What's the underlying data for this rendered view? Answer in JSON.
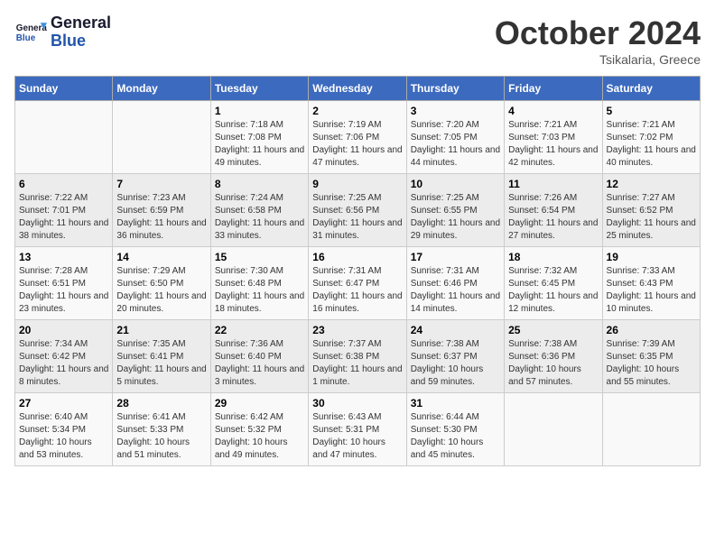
{
  "header": {
    "logo_general": "General",
    "logo_blue": "Blue",
    "month_title": "October 2024",
    "location": "Tsikalaria, Greece"
  },
  "weekdays": [
    "Sunday",
    "Monday",
    "Tuesday",
    "Wednesday",
    "Thursday",
    "Friday",
    "Saturday"
  ],
  "weeks": [
    [
      {
        "day": "",
        "sunrise": "",
        "sunset": "",
        "daylight": ""
      },
      {
        "day": "",
        "sunrise": "",
        "sunset": "",
        "daylight": ""
      },
      {
        "day": "1",
        "sunrise": "Sunrise: 7:18 AM",
        "sunset": "Sunset: 7:08 PM",
        "daylight": "Daylight: 11 hours and 49 minutes."
      },
      {
        "day": "2",
        "sunrise": "Sunrise: 7:19 AM",
        "sunset": "Sunset: 7:06 PM",
        "daylight": "Daylight: 11 hours and 47 minutes."
      },
      {
        "day": "3",
        "sunrise": "Sunrise: 7:20 AM",
        "sunset": "Sunset: 7:05 PM",
        "daylight": "Daylight: 11 hours and 44 minutes."
      },
      {
        "day": "4",
        "sunrise": "Sunrise: 7:21 AM",
        "sunset": "Sunset: 7:03 PM",
        "daylight": "Daylight: 11 hours and 42 minutes."
      },
      {
        "day": "5",
        "sunrise": "Sunrise: 7:21 AM",
        "sunset": "Sunset: 7:02 PM",
        "daylight": "Daylight: 11 hours and 40 minutes."
      }
    ],
    [
      {
        "day": "6",
        "sunrise": "Sunrise: 7:22 AM",
        "sunset": "Sunset: 7:01 PM",
        "daylight": "Daylight: 11 hours and 38 minutes."
      },
      {
        "day": "7",
        "sunrise": "Sunrise: 7:23 AM",
        "sunset": "Sunset: 6:59 PM",
        "daylight": "Daylight: 11 hours and 36 minutes."
      },
      {
        "day": "8",
        "sunrise": "Sunrise: 7:24 AM",
        "sunset": "Sunset: 6:58 PM",
        "daylight": "Daylight: 11 hours and 33 minutes."
      },
      {
        "day": "9",
        "sunrise": "Sunrise: 7:25 AM",
        "sunset": "Sunset: 6:56 PM",
        "daylight": "Daylight: 11 hours and 31 minutes."
      },
      {
        "day": "10",
        "sunrise": "Sunrise: 7:25 AM",
        "sunset": "Sunset: 6:55 PM",
        "daylight": "Daylight: 11 hours and 29 minutes."
      },
      {
        "day": "11",
        "sunrise": "Sunrise: 7:26 AM",
        "sunset": "Sunset: 6:54 PM",
        "daylight": "Daylight: 11 hours and 27 minutes."
      },
      {
        "day": "12",
        "sunrise": "Sunrise: 7:27 AM",
        "sunset": "Sunset: 6:52 PM",
        "daylight": "Daylight: 11 hours and 25 minutes."
      }
    ],
    [
      {
        "day": "13",
        "sunrise": "Sunrise: 7:28 AM",
        "sunset": "Sunset: 6:51 PM",
        "daylight": "Daylight: 11 hours and 23 minutes."
      },
      {
        "day": "14",
        "sunrise": "Sunrise: 7:29 AM",
        "sunset": "Sunset: 6:50 PM",
        "daylight": "Daylight: 11 hours and 20 minutes."
      },
      {
        "day": "15",
        "sunrise": "Sunrise: 7:30 AM",
        "sunset": "Sunset: 6:48 PM",
        "daylight": "Daylight: 11 hours and 18 minutes."
      },
      {
        "day": "16",
        "sunrise": "Sunrise: 7:31 AM",
        "sunset": "Sunset: 6:47 PM",
        "daylight": "Daylight: 11 hours and 16 minutes."
      },
      {
        "day": "17",
        "sunrise": "Sunrise: 7:31 AM",
        "sunset": "Sunset: 6:46 PM",
        "daylight": "Daylight: 11 hours and 14 minutes."
      },
      {
        "day": "18",
        "sunrise": "Sunrise: 7:32 AM",
        "sunset": "Sunset: 6:45 PM",
        "daylight": "Daylight: 11 hours and 12 minutes."
      },
      {
        "day": "19",
        "sunrise": "Sunrise: 7:33 AM",
        "sunset": "Sunset: 6:43 PM",
        "daylight": "Daylight: 11 hours and 10 minutes."
      }
    ],
    [
      {
        "day": "20",
        "sunrise": "Sunrise: 7:34 AM",
        "sunset": "Sunset: 6:42 PM",
        "daylight": "Daylight: 11 hours and 8 minutes."
      },
      {
        "day": "21",
        "sunrise": "Sunrise: 7:35 AM",
        "sunset": "Sunset: 6:41 PM",
        "daylight": "Daylight: 11 hours and 5 minutes."
      },
      {
        "day": "22",
        "sunrise": "Sunrise: 7:36 AM",
        "sunset": "Sunset: 6:40 PM",
        "daylight": "Daylight: 11 hours and 3 minutes."
      },
      {
        "day": "23",
        "sunrise": "Sunrise: 7:37 AM",
        "sunset": "Sunset: 6:38 PM",
        "daylight": "Daylight: 11 hours and 1 minute."
      },
      {
        "day": "24",
        "sunrise": "Sunrise: 7:38 AM",
        "sunset": "Sunset: 6:37 PM",
        "daylight": "Daylight: 10 hours and 59 minutes."
      },
      {
        "day": "25",
        "sunrise": "Sunrise: 7:38 AM",
        "sunset": "Sunset: 6:36 PM",
        "daylight": "Daylight: 10 hours and 57 minutes."
      },
      {
        "day": "26",
        "sunrise": "Sunrise: 7:39 AM",
        "sunset": "Sunset: 6:35 PM",
        "daylight": "Daylight: 10 hours and 55 minutes."
      }
    ],
    [
      {
        "day": "27",
        "sunrise": "Sunrise: 6:40 AM",
        "sunset": "Sunset: 5:34 PM",
        "daylight": "Daylight: 10 hours and 53 minutes."
      },
      {
        "day": "28",
        "sunrise": "Sunrise: 6:41 AM",
        "sunset": "Sunset: 5:33 PM",
        "daylight": "Daylight: 10 hours and 51 minutes."
      },
      {
        "day": "29",
        "sunrise": "Sunrise: 6:42 AM",
        "sunset": "Sunset: 5:32 PM",
        "daylight": "Daylight: 10 hours and 49 minutes."
      },
      {
        "day": "30",
        "sunrise": "Sunrise: 6:43 AM",
        "sunset": "Sunset: 5:31 PM",
        "daylight": "Daylight: 10 hours and 47 minutes."
      },
      {
        "day": "31",
        "sunrise": "Sunrise: 6:44 AM",
        "sunset": "Sunset: 5:30 PM",
        "daylight": "Daylight: 10 hours and 45 minutes."
      },
      {
        "day": "",
        "sunrise": "",
        "sunset": "",
        "daylight": ""
      },
      {
        "day": "",
        "sunrise": "",
        "sunset": "",
        "daylight": ""
      }
    ]
  ]
}
